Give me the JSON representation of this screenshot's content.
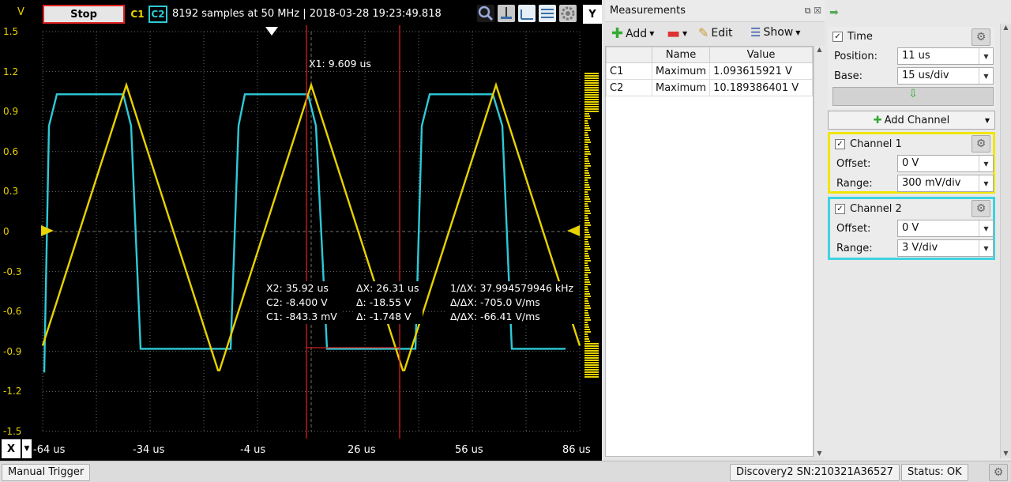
{
  "toolbar": {
    "y_unit": "V",
    "stop_label": "Stop",
    "c1_label": "C1",
    "c2_label": "C2",
    "acq_info": "8192 samples at 50 MHz | 2018-03-28 19:23:49.818",
    "y_button": "Y"
  },
  "plot": {
    "y_ticks": [
      "1.5",
      "1.2",
      "0.9",
      "0.6",
      "0.3",
      "0",
      "-0.3",
      "-0.6",
      "-0.9",
      "-1.2",
      "-1.5"
    ],
    "x_ticks": [
      "-64 us",
      "-34 us",
      "-4 us",
      "26 us",
      "56 us",
      "86 us"
    ],
    "x_button": "X",
    "colors": {
      "ch1": "#e8d200",
      "ch2": "#2ec9d6",
      "cursor": "#d42020",
      "grid": "#6e6e6e"
    },
    "cursor_x1": "X1: 9.609 us",
    "cursor_block1": [
      "X2: 35.92 us",
      "C2: -8.400 V",
      "C1: -843.3 mV"
    ],
    "cursor_block2": [
      "ΔX: 26.31 us",
      "Δ: -18.55 V",
      "Δ: -1.748 V"
    ],
    "cursor_block3": [
      "1/ΔX: 37.994579946 kHz",
      "Δ/ΔX: -705.0 V/ms",
      "Δ/ΔX: -66.41 V/ms"
    ]
  },
  "measurements": {
    "title": "Measurements",
    "add_label": "Add",
    "edit_label": "Edit",
    "show_label": "Show",
    "columns": [
      "",
      "Name",
      "Value"
    ],
    "rows": [
      [
        "C1",
        "Maximum",
        "1.093615921 V"
      ],
      [
        "C2",
        "Maximum",
        "10.189386401 V"
      ]
    ]
  },
  "settings": {
    "time_label": "Time",
    "position_label": "Position:",
    "position_value": "11 us",
    "base_label": "Base:",
    "base_value": "15 us/div",
    "add_channel_label": "Add Channel",
    "ch1": {
      "label": "Channel 1",
      "offset_label": "Offset:",
      "offset_value": "0 V",
      "range_label": "Range:",
      "range_value": "300 mV/div"
    },
    "ch2": {
      "label": "Channel 2",
      "offset_label": "Offset:",
      "offset_value": "0 V",
      "range_label": "Range:",
      "range_value": "3 V/div"
    }
  },
  "statusbar": {
    "manual_trigger": "Manual Trigger",
    "device": "Discovery2 SN:210321A36527",
    "status": "Status: OK"
  }
}
